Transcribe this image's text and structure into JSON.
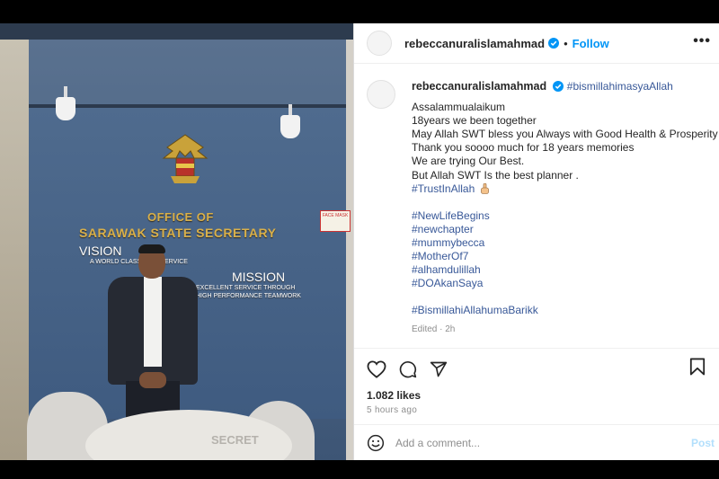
{
  "post": {
    "author": "rebeccanuralislamahmad",
    "follow_label": "Follow",
    "header_separator": "•",
    "more_label": "•••",
    "caption_title_tag": "#bismillahimasyaAllah",
    "caption_lines": [
      "Assalammualaikum",
      "18years we been together",
      "May Allah SWT bless you Always with Good Health & Prosperity .",
      "Thank you soooo much for 18 years memories",
      "We are trying Our Best.",
      "But Allah SWT Is the best planner ."
    ],
    "trust_tag": "#TrustInAllah",
    "hashtags": [
      "#NewLifeBegins",
      "#newchapter",
      "#mummybecca",
      "#MotherOf7",
      "#alhamdulillah",
      "#DOAkanSaya"
    ],
    "final_tag": "#BismillahiAllahumaBarikk",
    "edited": "Edited · 2h",
    "likes": "1.082 likes",
    "time_ago": "5 hours ago",
    "comment_placeholder": "Add a comment...",
    "post_label": "Post"
  },
  "photo": {
    "sign_title_1": "OFFICE OF",
    "sign_title_2": "SARAWAK STATE SECRETARY",
    "vision_title": "VISION",
    "vision_text": "A WORLD CLASS CIVIL SERVICE",
    "mission_title": "MISSION",
    "mission_text_1": "EXCELLENT SERVICE THROUGH",
    "mission_text_2": "HIGH PERFORMANCE TEAMWORK",
    "notice_text": "FACE MASK",
    "table_text": "SECRET"
  },
  "colors": {
    "link": "#385898",
    "follow": "#0095f6",
    "verified": "#0095f6"
  },
  "icons": [
    "verified-badge-icon",
    "heart-icon",
    "comment-icon",
    "share-icon",
    "bookmark-icon",
    "emoji-icon",
    "more-options-icon"
  ]
}
